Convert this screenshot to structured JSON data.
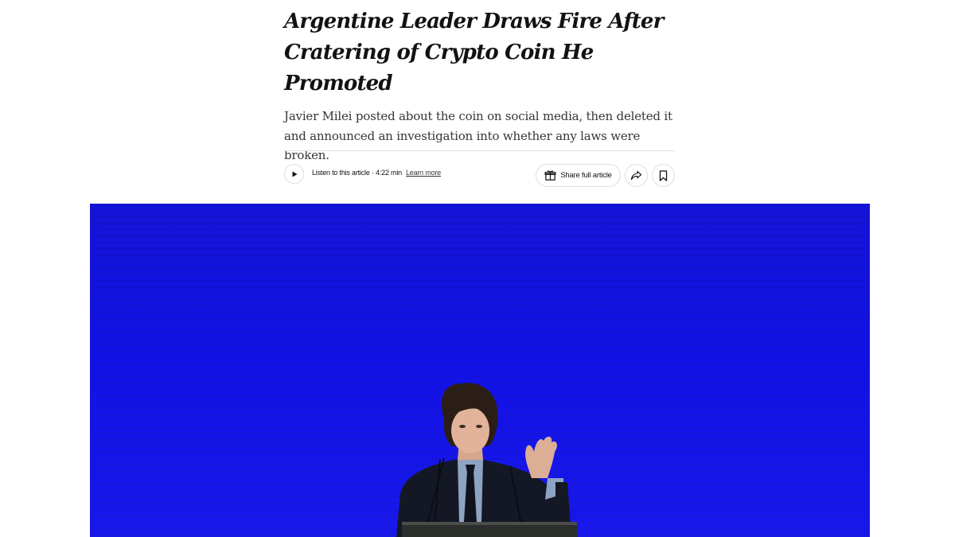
{
  "article": {
    "headline": "Argentine Leader Draws Fire After\nCratering of Crypto Coin He Promoted",
    "summary": "Javier Milei posted about the coin on social media, then deleted it\nand announced an investigation into whether any laws were\nbroken."
  },
  "toolbar": {
    "listen_label": "Listen to this article · 4:22 min",
    "learn_more": "Learn more",
    "share_full_label": "Share full article",
    "icons": {
      "play": "play-icon",
      "gift": "gift-icon",
      "share": "share-arrow-icon",
      "bookmark": "bookmark-icon"
    }
  },
  "hero": {
    "background_color": "#1414e0",
    "subject": "speaker-at-podium"
  },
  "colors": {
    "text": "#121212",
    "secondary_text": "#363636",
    "divider": "#dfdfdf"
  }
}
